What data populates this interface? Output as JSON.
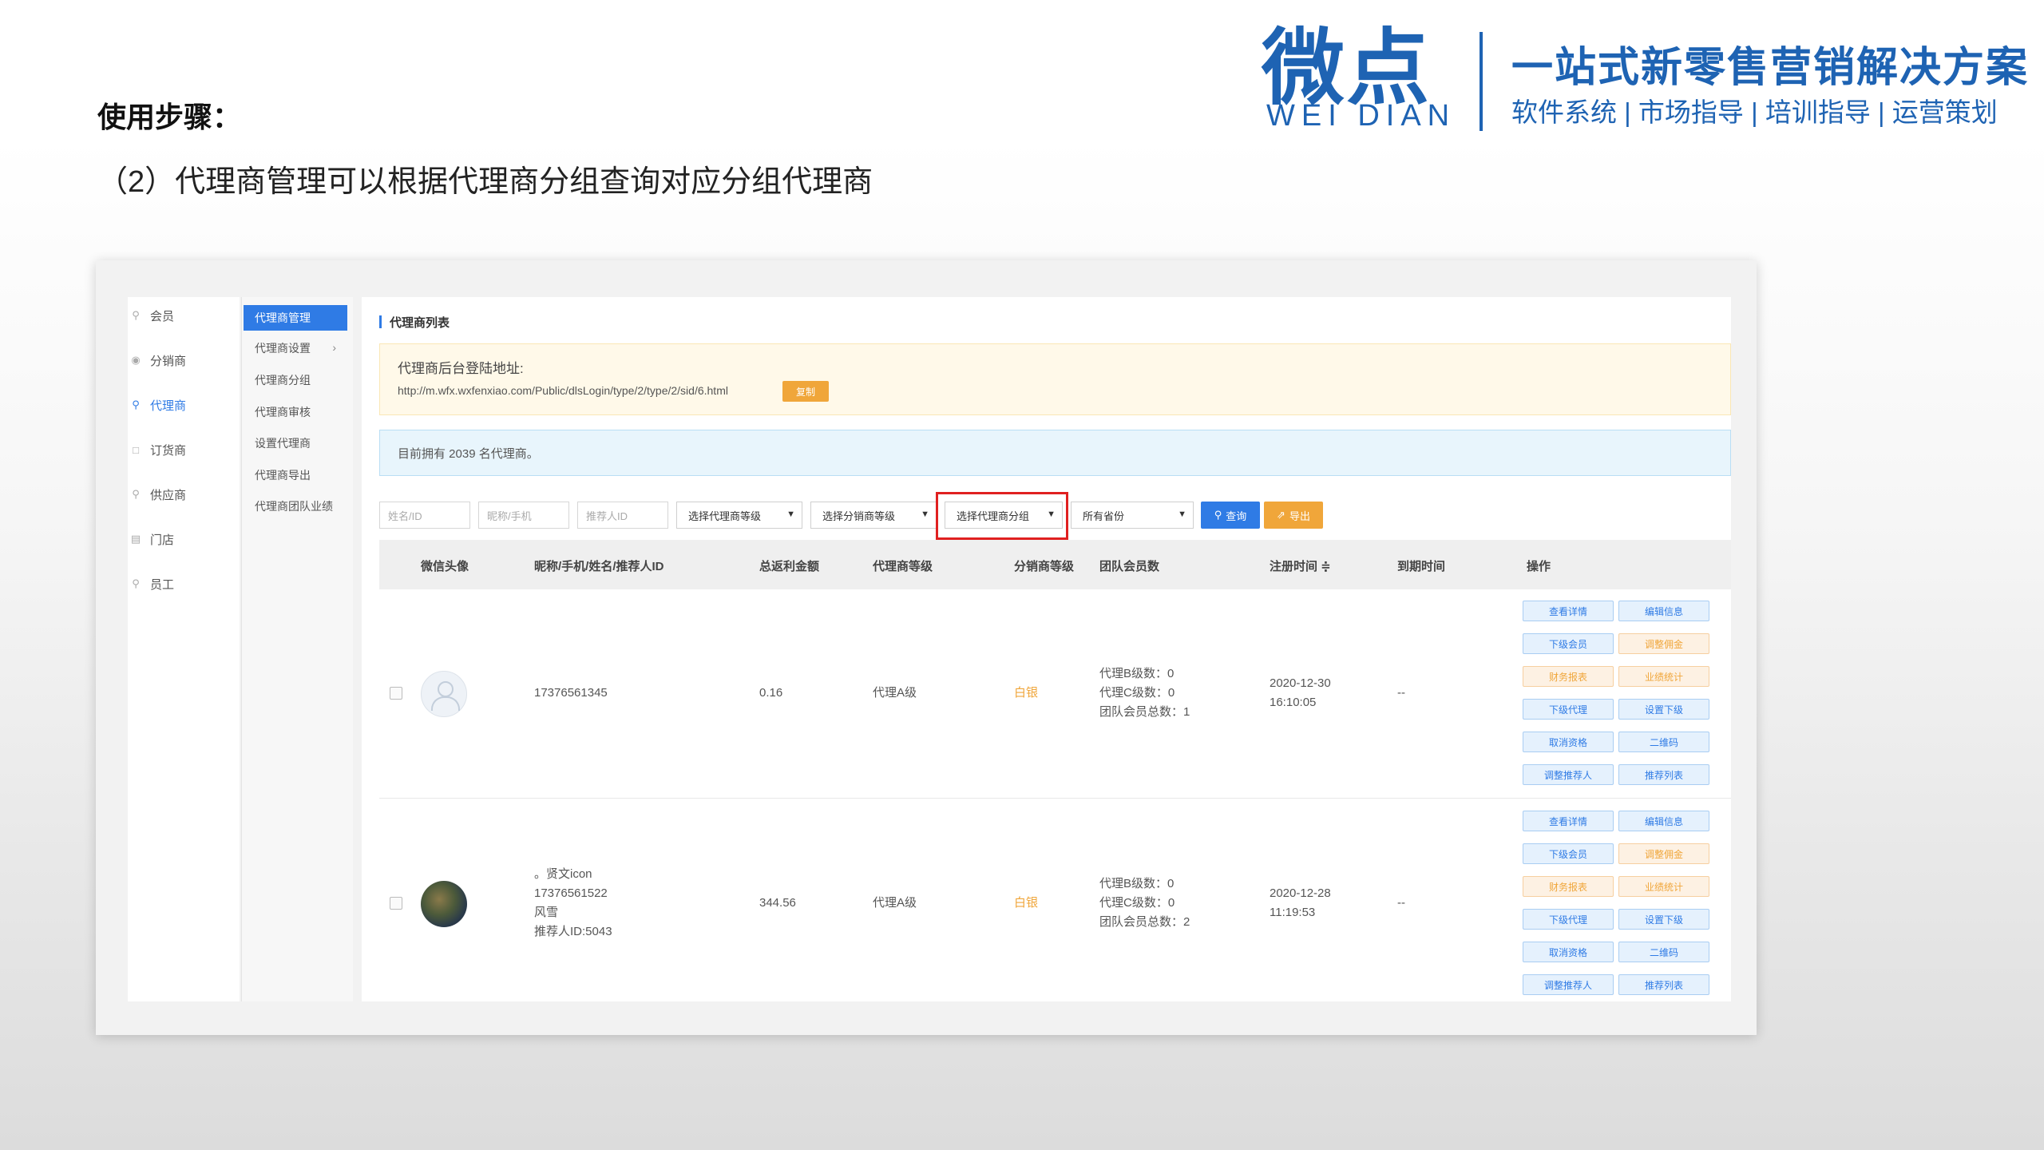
{
  "slide": {
    "heading": "使用步骤：",
    "subtitle": "（2）代理商管理可以根据代理商分组查询对应分组代理商"
  },
  "brand": {
    "logo_cn": "微点",
    "logo_en": "WEI DIAN",
    "slogan": "一站式新零售营销解决方案",
    "services": "软件系统 | 市场指导 | 培训指导 | 运营策划",
    "color": "#1e63b3"
  },
  "sidebar": {
    "items": [
      {
        "label": "会员",
        "icon": "user-icon"
      },
      {
        "label": "分销商",
        "icon": "group-icon"
      },
      {
        "label": "代理商",
        "icon": "agent-icon",
        "active": true
      },
      {
        "label": "订货商",
        "icon": "order-icon"
      },
      {
        "label": "供应商",
        "icon": "supplier-icon"
      },
      {
        "label": "门店",
        "icon": "store-icon"
      },
      {
        "label": "员工",
        "icon": "staff-icon"
      }
    ]
  },
  "subnav": {
    "items": [
      {
        "label": "代理商管理",
        "active": true
      },
      {
        "label": "代理商设置",
        "has_chevron": true
      },
      {
        "label": "代理商分组"
      },
      {
        "label": "代理商审核"
      },
      {
        "label": "设置代理商"
      },
      {
        "label": "代理商导出"
      },
      {
        "label": "代理商团队业绩"
      }
    ]
  },
  "main": {
    "title": "代理商列表",
    "login_label": "代理商后台登陆地址:",
    "login_url": "http://m.wfx.wxfenxiao.com/Public/dlsLogin/type/2/type/2/sid/6.html",
    "copy_button": "复制",
    "count_text": "目前拥有 2039 名代理商。"
  },
  "filters": {
    "name_placeholder": "姓名/ID",
    "nick_placeholder": "昵称/手机",
    "referrer_placeholder": "推荐人ID",
    "agent_level": "选择代理商等级",
    "dist_level": "选择分销商等级",
    "agent_group": "选择代理商分组",
    "province": "所有省份",
    "query_button": "查询",
    "export_button": "导出"
  },
  "table": {
    "headers": [
      "微信头像",
      "昵称/手机/姓名/推荐人ID",
      "总返利金额",
      "代理商等级",
      "分销商等级",
      "团队会员数",
      "注册时间 ≑",
      "到期时间",
      "操作"
    ],
    "rows": [
      {
        "info_lines": [
          "17376561345"
        ],
        "rebate": "0.16",
        "agent_level": "代理A级",
        "dist_level": "白银",
        "team_lines": [
          "代理B级数：0",
          "代理C级数：0",
          "团队会员总数：1"
        ],
        "reg_date": "2020-12-30",
        "reg_time": "16:10:05",
        "expire": "--",
        "avatar": "default"
      },
      {
        "info_lines": [
          "。贤文icon",
          "17376561522",
          "风雪",
          "推荐人ID:5043"
        ],
        "rebate": "344.56",
        "agent_level": "代理A级",
        "dist_level": "白银",
        "team_lines": [
          "代理B级数：0",
          "代理C级数：0",
          "团队会员总数：2"
        ],
        "reg_date": "2020-12-28",
        "reg_time": "11:19:53",
        "expire": "--",
        "avatar": "photo"
      }
    ],
    "ops": [
      [
        {
          "label": "查看详情",
          "tone": "blue"
        },
        {
          "label": "编辑信息",
          "tone": "blue"
        }
      ],
      [
        {
          "label": "下级会员",
          "tone": "blue"
        },
        {
          "label": "调整佣金",
          "tone": "orange"
        }
      ],
      [
        {
          "label": "财务报表",
          "tone": "orange"
        },
        {
          "label": "业绩统计",
          "tone": "orange"
        }
      ],
      [
        {
          "label": "下级代理",
          "tone": "blue"
        },
        {
          "label": "设置下级",
          "tone": "blue"
        }
      ],
      [
        {
          "label": "取消资格",
          "tone": "blue"
        },
        {
          "label": "二维码",
          "tone": "blue"
        }
      ],
      [
        {
          "label": "调整推荐人",
          "tone": "blue"
        },
        {
          "label": "推荐列表",
          "tone": "blue"
        }
      ]
    ]
  }
}
